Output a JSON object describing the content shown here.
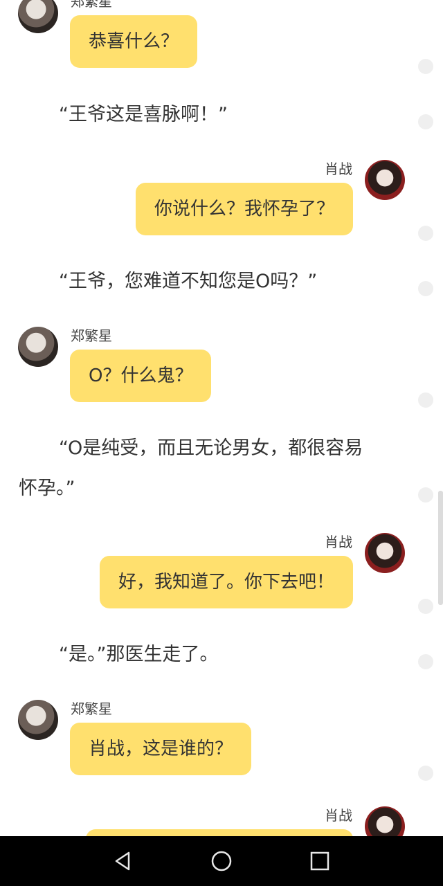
{
  "characters": {
    "a": "郑繁星",
    "b": "肖战"
  },
  "messages": [
    {
      "text": "恭喜什么？"
    },
    {
      "text": "“王爷这是喜脉啊！”"
    },
    {
      "name": "肖战",
      "text": "你说什么？我怀孕了？"
    },
    {
      "text": "“王爷，您难道不知您是O吗？”"
    },
    {
      "name": "郑繁星",
      "text": "O？什么鬼？"
    },
    {
      "text_line1": "“O是纯受，而且无论男女，都很容易",
      "text_line2": "怀孕。”"
    },
    {
      "name": "肖战",
      "text": "好，我知道了。你下去吧！"
    },
    {
      "text": "“是。”那医生走了。"
    },
    {
      "name": "郑繁星",
      "text": "肖战，这是谁的？"
    },
    {
      "name": "肖战"
    }
  ],
  "colors": {
    "bubble": "#ffe06e",
    "background": "#ffffff",
    "navbar": "#000000"
  },
  "navbar": {
    "back": "back-triangle-icon",
    "home": "home-circle-icon",
    "recents": "recents-square-icon"
  }
}
